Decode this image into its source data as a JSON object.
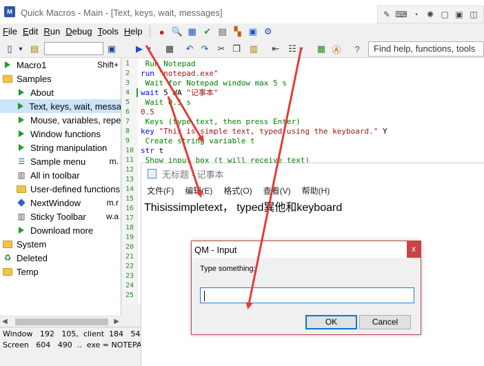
{
  "app": {
    "title": "Quick Macros - Main - [Text, keys, wait, messages]",
    "icon_text": "M"
  },
  "title_tools": [
    "pen-icon",
    "keyboard-icon",
    "tag-icon",
    "spinner-icon",
    "window-icon",
    "folder-search-icon",
    "window-split-icon"
  ],
  "menu": {
    "items": [
      {
        "label": "File",
        "accel": "F",
        "rest": "ile"
      },
      {
        "label": "Edit",
        "accel": "E",
        "rest": "dit"
      },
      {
        "label": "Run",
        "accel": "R",
        "rest": "un"
      },
      {
        "label": "Debug",
        "accel": "D",
        "rest": "ebug"
      },
      {
        "label": "Tools",
        "accel": "T",
        "rest": "ools"
      },
      {
        "label": "Help",
        "accel": "H",
        "rest": "elp"
      }
    ]
  },
  "toolbar": {
    "search_placeholder": "Find help, functions, tools"
  },
  "tree": {
    "items": [
      {
        "label": "Macro1",
        "extra": "Shift+",
        "icon": "play-icon"
      },
      {
        "label": "Samples",
        "extra": "",
        "icon": "folder-icon"
      },
      {
        "label": "About",
        "extra": "",
        "icon": "play-icon"
      },
      {
        "label": "Text, keys, wait, messa",
        "extra": "",
        "icon": "play-icon",
        "selected": true
      },
      {
        "label": "Mouse, variables, repe",
        "extra": "",
        "icon": "play-icon"
      },
      {
        "label": "Window functions",
        "extra": "",
        "icon": "play-icon"
      },
      {
        "label": "String manipulation",
        "extra": "",
        "icon": "play-icon"
      },
      {
        "label": "Sample menu",
        "extra": "m.",
        "icon": "menu-icon"
      },
      {
        "label": "All in toolbar",
        "extra": "",
        "icon": "toolbar-icon"
      },
      {
        "label": "User-defined functions",
        "extra": "",
        "icon": "folder-icon"
      },
      {
        "label": "NextWindow",
        "extra": "m.r",
        "icon": "diamond-icon"
      },
      {
        "label": "Sticky Toolbar",
        "extra": "w.a",
        "icon": "toolbar-icon"
      },
      {
        "label": "Download more",
        "extra": "",
        "icon": "play-icon"
      },
      {
        "label": "System",
        "extra": "",
        "icon": "folder-icon"
      },
      {
        "label": "Deleted",
        "extra": "",
        "icon": "recycle-icon"
      },
      {
        "label": "Temp",
        "extra": "",
        "icon": "folder-icon"
      }
    ]
  },
  "status": {
    "line1": "Window   192   105,  client  184   54",
    "line2": "Screen   604   490  ..  exe = NOTEPA"
  },
  "editor": {
    "lines": [
      {
        "n": "1",
        "parts": [
          {
            "c": "com",
            "t": " Run Notepad"
          }
        ]
      },
      {
        "n": "2",
        "parts": [
          {
            "c": "kw",
            "t": "run"
          },
          {
            "c": "str",
            "t": " \"notepad.exe\""
          }
        ]
      },
      {
        "n": "3",
        "parts": [
          {
            "c": "com",
            "t": " Wait for Notepad window max 5 s"
          }
        ]
      },
      {
        "n": "4",
        "parts": [
          {
            "c": "kw",
            "t": "wait"
          },
          {
            "c": "tx",
            "t": " 5 WA "
          },
          {
            "c": "str",
            "t": "\"记事本\""
          }
        ]
      },
      {
        "n": "5",
        "parts": [
          {
            "c": "com",
            "t": " Wait 0.5 s"
          }
        ]
      },
      {
        "n": "6",
        "parts": [
          {
            "c": "str",
            "t": "0.5"
          }
        ]
      },
      {
        "n": "7",
        "parts": [
          {
            "c": "com",
            "t": " Keys (type text, then press Enter)"
          }
        ]
      },
      {
        "n": "8",
        "parts": [
          {
            "c": "kw",
            "t": "key"
          },
          {
            "c": "str",
            "t": " \"This is simple text, typed using the keyboard.\""
          },
          {
            "c": "tx",
            "t": " Y"
          }
        ]
      },
      {
        "n": "9",
        "parts": [
          {
            "c": "com",
            "t": " Create string variable t"
          }
        ]
      },
      {
        "n": "10",
        "parts": [
          {
            "c": "kw",
            "t": "str"
          },
          {
            "c": "tx",
            "t": " t"
          }
        ]
      },
      {
        "n": "11",
        "parts": [
          {
            "c": "com",
            "t": " Show input box (t will receive text)"
          }
        ]
      },
      {
        "n": "12",
        "parts": []
      },
      {
        "n": "13",
        "parts": []
      },
      {
        "n": "14",
        "parts": []
      },
      {
        "n": "15",
        "parts": []
      },
      {
        "n": "16",
        "parts": []
      },
      {
        "n": "17",
        "parts": []
      },
      {
        "n": "18",
        "parts": []
      },
      {
        "n": "19",
        "parts": []
      },
      {
        "n": "20",
        "parts": []
      },
      {
        "n": "21",
        "parts": []
      },
      {
        "n": "22",
        "parts": []
      },
      {
        "n": "23",
        "parts": []
      },
      {
        "n": "24",
        "parts": []
      },
      {
        "n": "25",
        "parts": []
      }
    ]
  },
  "notepad": {
    "title": "无标题 - 记事本",
    "menu": [
      "文件(F)",
      "编辑(E)",
      "格式(O)",
      "查看(V)",
      "帮助(H)"
    ],
    "text": "Thisissimpletext， typed巽他和keyboard"
  },
  "dialog": {
    "title": "QM - Input",
    "prompt": "Type something:",
    "input_value": "",
    "ok_label": "OK",
    "cancel_label": "Cancel",
    "close_glyph": "x"
  },
  "colors": {
    "arrow": "#e53935",
    "selection": "#cce4f7",
    "play": "#1f9d1f",
    "comment": "#008000",
    "keyword": "#0000ff",
    "string": "#a31515"
  }
}
